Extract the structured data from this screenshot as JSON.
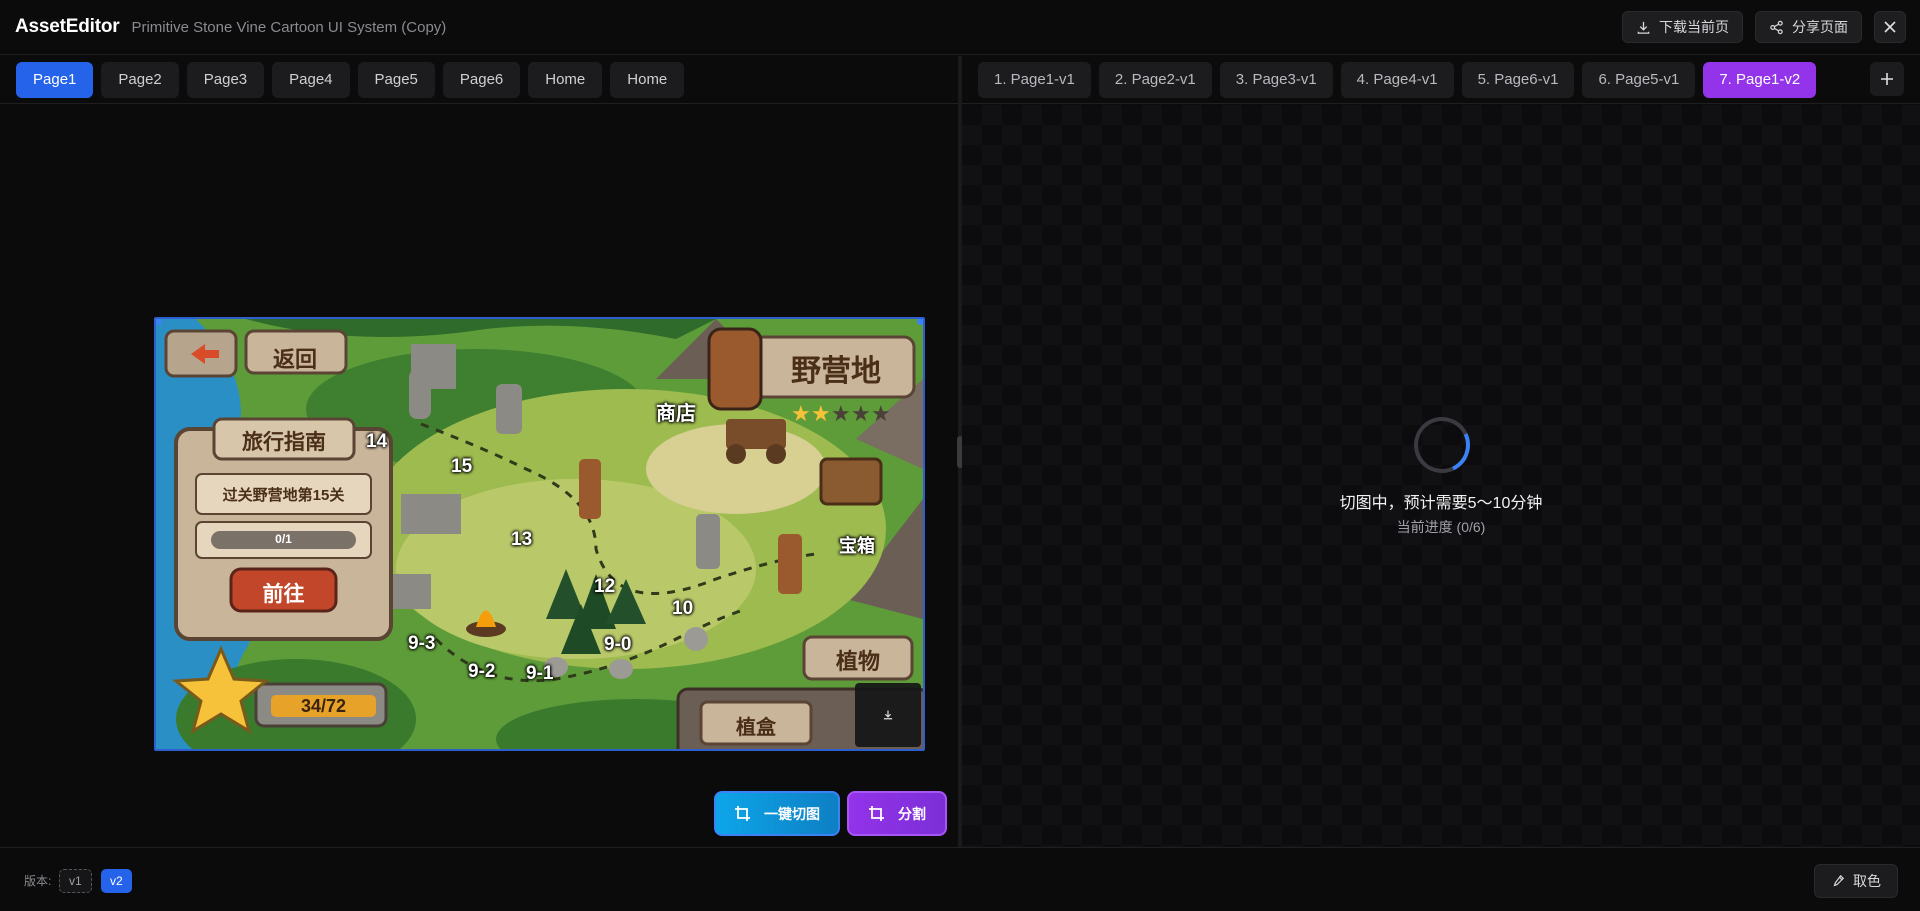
{
  "header": {
    "brand": "AssetEditor",
    "subtitle": "Primitive Stone Vine Cartoon UI System (Copy)",
    "download_label": "下载当前页",
    "share_label": "分享页面"
  },
  "left_tabs": [
    "Page1",
    "Page2",
    "Page3",
    "Page4",
    "Page5",
    "Page6",
    "Home",
    "Home"
  ],
  "right_tabs": [
    "1. Page1-v1",
    "2. Page2-v1",
    "3. Page3-v1",
    "4. Page4-v1",
    "5. Page6-v1",
    "6. Page5-v1",
    "7. Page1-v2"
  ],
  "right_panel": {
    "loading_text": "切图中，预计需要5～10分钟",
    "progress_text": "当前进度 (0/6)"
  },
  "scene": {
    "back_label": "返回",
    "title": "野营地",
    "shop": "商店",
    "chest": "宝箱",
    "plants": "植物",
    "plant_box": "植盒",
    "guide_title": "旅行指南",
    "guide_task": "过关野营地第15关",
    "guide_progress": "0/1",
    "go_label": "前往",
    "star_count": "34/72",
    "stars_filled": 2,
    "stars_total": 5,
    "levels": [
      "14",
      "15",
      "13",
      "12",
      "10",
      "9-3",
      "9-2",
      "9-1",
      "9-0"
    ]
  },
  "actions": {
    "cut_label": "一键切图",
    "split_label": "分割"
  },
  "footer": {
    "version_label": "版本:",
    "versions": [
      "v1",
      "v2"
    ],
    "pick_color_label": "取色"
  },
  "colors": {
    "accent_blue": "#2563eb",
    "accent_purple": "#9333ea",
    "cut_button": "#0ea5e9"
  }
}
